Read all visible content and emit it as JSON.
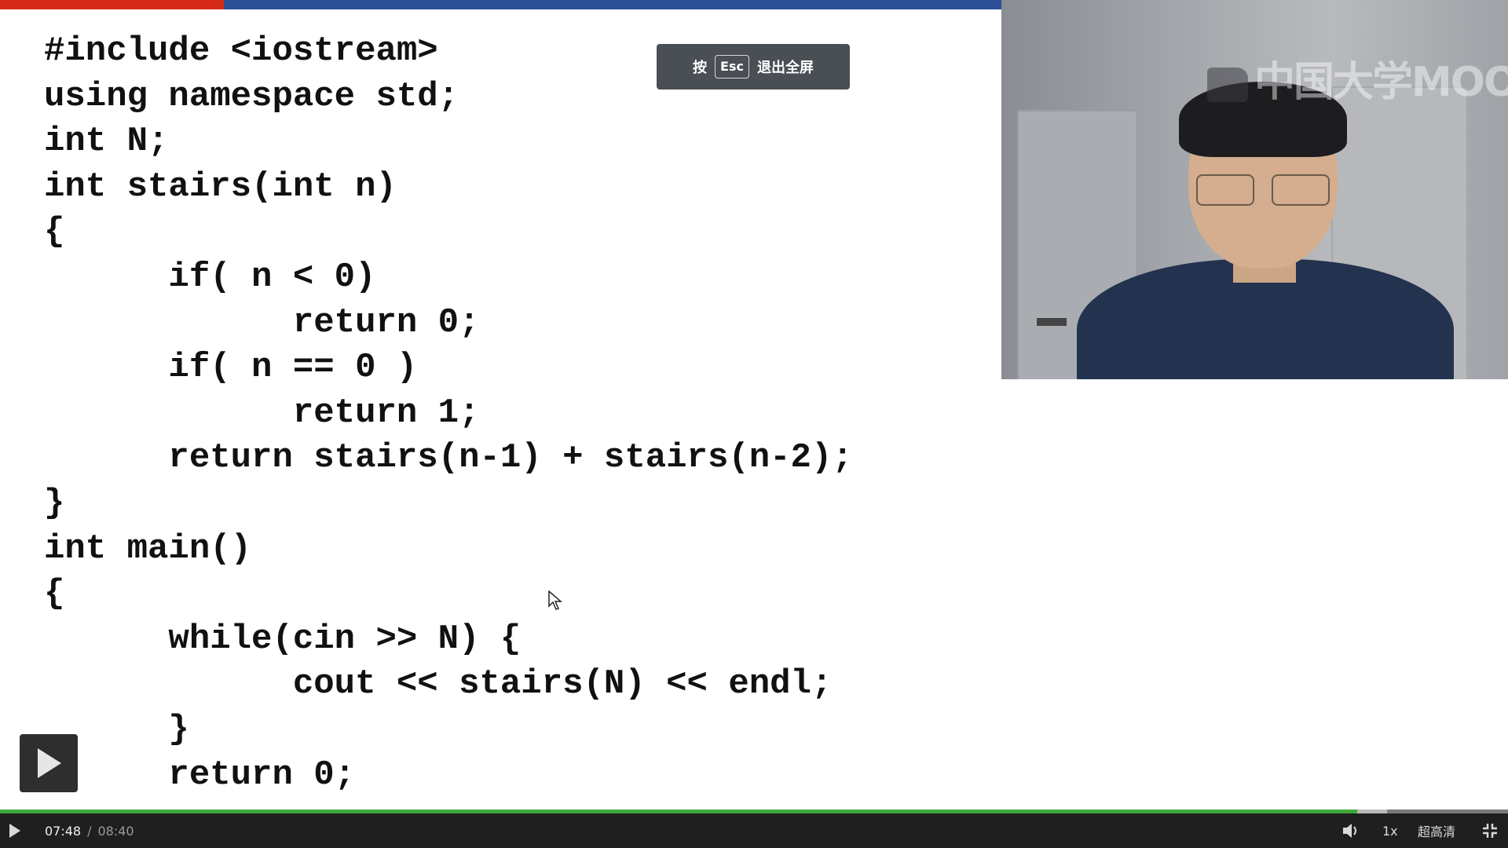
{
  "slide": {
    "code_lines": [
      "#include <iostream>",
      "using namespace std;",
      "int N;",
      "int stairs(int n)",
      "{",
      "      if( n < 0)",
      "            return 0;",
      "      if( n == 0 )",
      "            return 1;",
      "      return stairs(n-1) + stairs(n-2);",
      "}",
      "int main()",
      "{",
      "      while(cin >> N) {",
      "            cout << stairs(N) << endl;",
      "      }",
      "      return 0;"
    ]
  },
  "esc_hint": {
    "prefix": "按",
    "key": "Esc",
    "suffix": "退出全屏"
  },
  "webcam": {
    "watermark": "中国大学MOOC"
  },
  "player": {
    "current_time": "07:48",
    "separator": "/",
    "total_time": "08:40",
    "progress_fraction": 0.9,
    "buffered_fraction": 0.92,
    "speed": "1x",
    "quality": "超高清",
    "play_icon": "play-icon",
    "volume_icon": "volume-icon",
    "exit_fullscreen_icon": "exit-fullscreen-icon",
    "accent_color": "#3da83a"
  }
}
